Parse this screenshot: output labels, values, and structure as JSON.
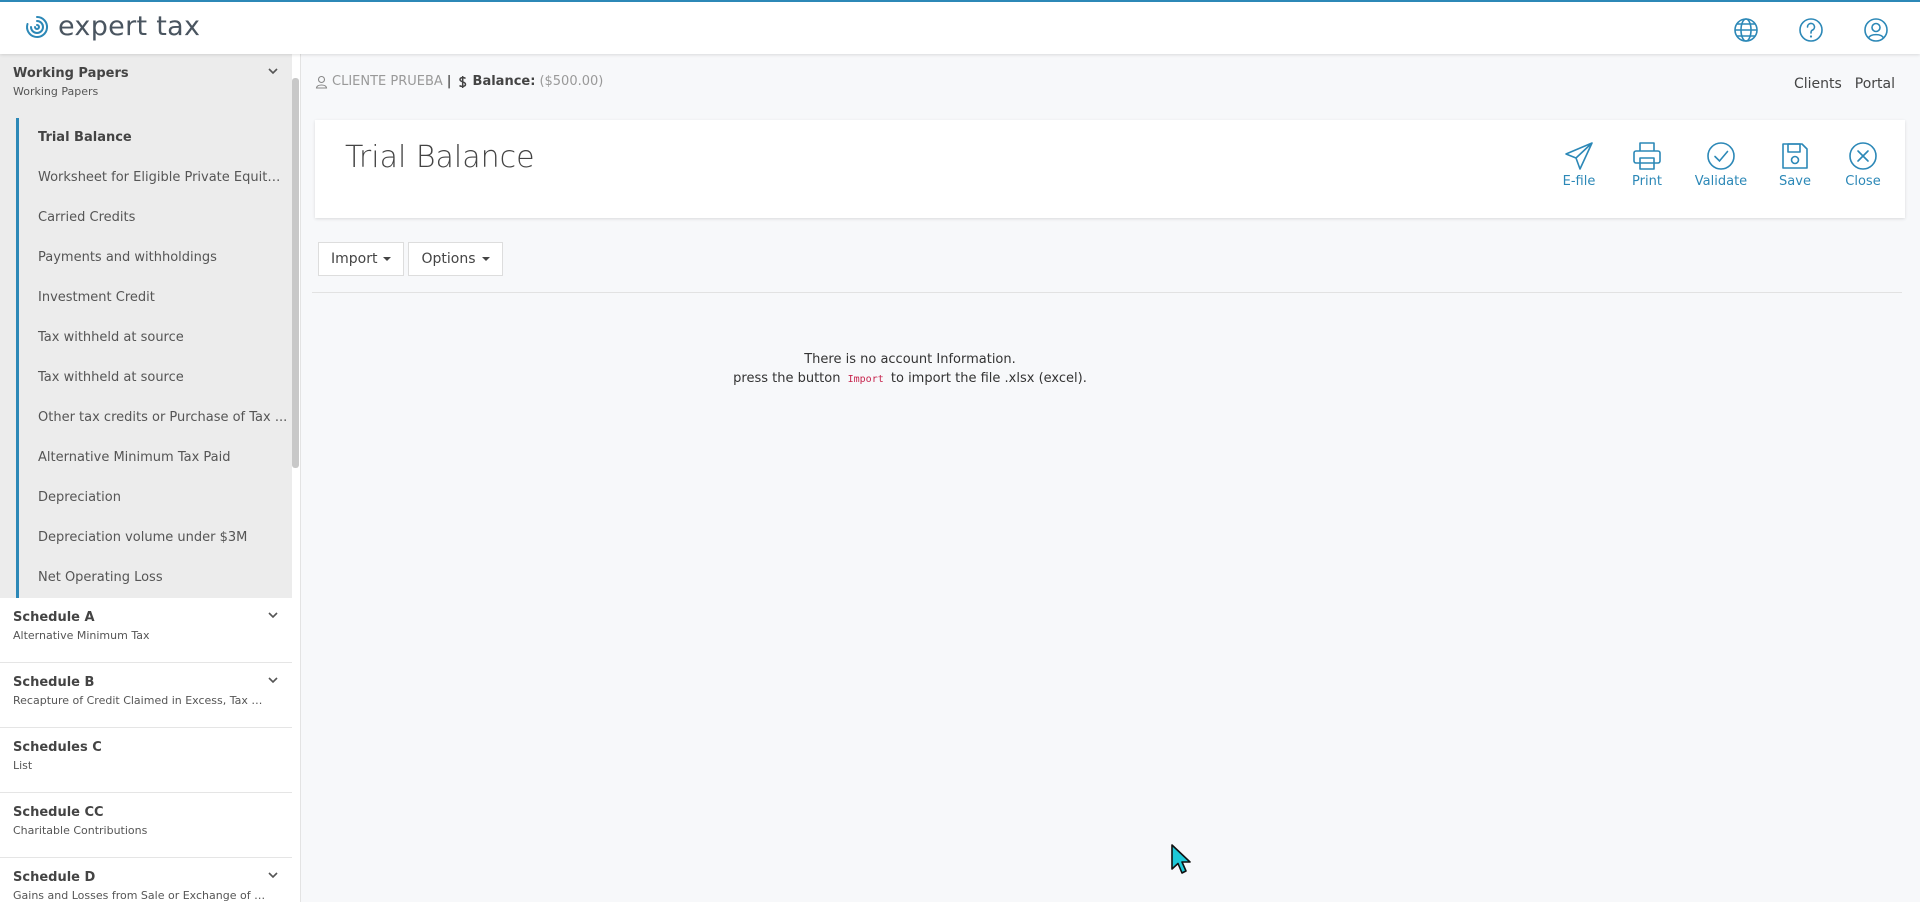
{
  "app": {
    "name": "expert tax"
  },
  "sidebar": {
    "open_group": {
      "title": "Working Papers",
      "subtitle": "Working Papers",
      "items": [
        {
          "label": "Trial Balance",
          "active": true
        },
        {
          "label": "Worksheet for Eligible Private Equity I..."
        },
        {
          "label": "Carried Credits"
        },
        {
          "label": "Payments and withholdings"
        },
        {
          "label": "Investment Credit"
        },
        {
          "label": "Tax withheld at source"
        },
        {
          "label": "Tax withheld at source"
        },
        {
          "label": "Other tax credits or Purchase of Tax ..."
        },
        {
          "label": "Alternative Minimum Tax Paid"
        },
        {
          "label": "Depreciation"
        },
        {
          "label": "Depreciation volume under $3M"
        },
        {
          "label": "Net Operating Loss"
        }
      ]
    },
    "groups": [
      {
        "title": "Schedule A",
        "subtitle": "Alternative Minimum Tax"
      },
      {
        "title": "Schedule B",
        "subtitle": "Recapture of Credit Claimed in Excess, Tax Cre..."
      },
      {
        "title": "Schedules C",
        "subtitle": "List"
      },
      {
        "title": "Schedule CC",
        "subtitle": "Charitable Contributions"
      },
      {
        "title": "Schedule D",
        "subtitle": "Gains and Losses from Sale or Exchange of Pro..."
      }
    ]
  },
  "header": {
    "client_name": "CLIENTE PRUEBA",
    "separator": "|",
    "balance_label": "Balance:",
    "balance_value": "($500.00)",
    "links": [
      "Clients",
      "Portal"
    ]
  },
  "page": {
    "title": "Trial Balance",
    "actions": [
      "E-file",
      "Print",
      "Validate",
      "Save",
      "Close"
    ]
  },
  "toolbar": {
    "import_label": "Import",
    "options_label": "Options"
  },
  "empty_state": {
    "line1": "There is no account Information.",
    "line2_before": "press the button",
    "line2_code": "Import",
    "line2_after": "to import the file .xlsx (excel)."
  },
  "colors": {
    "accent": "#2c88b7",
    "code": "#c7254e"
  }
}
